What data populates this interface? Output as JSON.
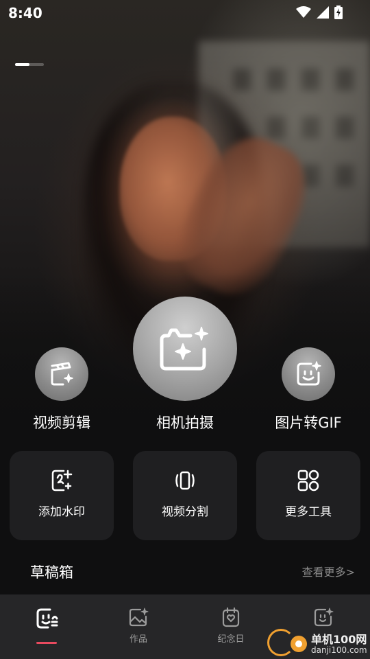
{
  "status_bar": {
    "time": "8:40",
    "icons": [
      "wifi-icon",
      "signal-icon",
      "battery-charging-icon"
    ]
  },
  "banner": {
    "progress": 0.5
  },
  "main_actions": [
    {
      "label": "视频剪辑",
      "icon": "clapper-sparkle-icon"
    },
    {
      "label": "相机拍摄",
      "icon": "camera-sparkle-icon"
    },
    {
      "label": "图片转GIF",
      "icon": "smile-face-sparkle-icon"
    }
  ],
  "tools": [
    {
      "label": "添加水印",
      "icon": "watermark-add-icon"
    },
    {
      "label": "视频分割",
      "icon": "video-split-icon"
    },
    {
      "label": "更多工具",
      "icon": "grid-tools-icon"
    }
  ],
  "drafts": {
    "title": "草稿箱",
    "more": "查看更多>"
  },
  "bottom_nav": [
    {
      "label": "",
      "icon": "home-face-icon",
      "active": true
    },
    {
      "label": "作品",
      "icon": "gallery-icon"
    },
    {
      "label": "纪念日",
      "icon": "calendar-heart-icon"
    },
    {
      "label": "",
      "icon": "profile-face-icon"
    }
  ],
  "watermark": {
    "line1": "单机100网",
    "line2": "danji100.com"
  },
  "colors": {
    "accent": "#e84a5f",
    "card_bg": "#1f1f21",
    "nav_bg": "#262628"
  }
}
